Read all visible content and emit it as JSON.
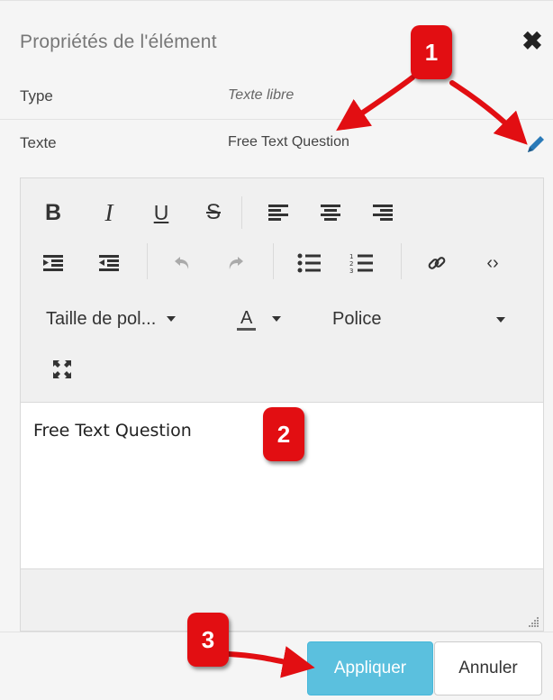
{
  "header": {
    "title": "Propriétés de l'élément",
    "close_icon": "close-icon"
  },
  "properties": [
    {
      "key": "Type",
      "value": "Texte libre"
    },
    {
      "key": "Texte",
      "value": "Free Text Question"
    }
  ],
  "toolbar": {
    "font_size_label": "Taille de pol...",
    "font_color_label": "A",
    "font_family_label": "Police",
    "icons": [
      "bold-icon",
      "italic-icon",
      "underline-icon",
      "strikethrough-icon",
      "align-left-icon",
      "align-center-icon",
      "align-right-icon",
      "indent-icon",
      "outdent-icon",
      "undo-icon",
      "redo-icon",
      "bullet-list-icon",
      "numbered-list-icon",
      "link-icon",
      "source-code-icon",
      "fullscreen-icon"
    ]
  },
  "editor": {
    "content": "Free Text Question"
  },
  "footer": {
    "apply_label": "Appliquer",
    "cancel_label": "Annuler"
  },
  "annotations": [
    {
      "label": "1"
    },
    {
      "label": "2"
    },
    {
      "label": "3"
    }
  ],
  "colors": {
    "apply": "#5bc0de",
    "annotation": "#e20e12",
    "pencil": "#2a7ab8"
  }
}
